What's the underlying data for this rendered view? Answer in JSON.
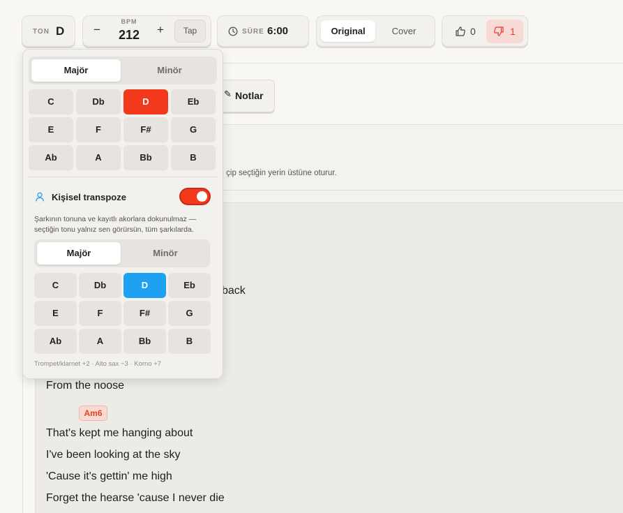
{
  "toolbar": {
    "key": {
      "label": "TON",
      "value": "D"
    },
    "bpm": {
      "label": "BPM",
      "value": "212",
      "minus": "−",
      "plus": "+",
      "tap": "Tap"
    },
    "duration": {
      "label": "SÜRE",
      "value": "6:00"
    },
    "version": {
      "options": [
        "Original",
        "Cover"
      ],
      "selected": "Original"
    },
    "votes": {
      "up": "0",
      "down": "1"
    }
  },
  "content": {
    "notes_button": "Notlar",
    "hint": "ç, çip seçtiğin yerin üstüne oturur.",
    "lyrics": [
      "back",
      "From the noose",
      "That's kept me hanging about",
      "I've been looking at the sky",
      "'Cause it's gettin' me high",
      "Forget the hearse 'cause I never die"
    ],
    "chord": "Am6"
  },
  "popover": {
    "mode_tabs": [
      "Majör",
      "Minör"
    ],
    "keys": [
      "C",
      "Db",
      "D",
      "Eb",
      "E",
      "F",
      "F#",
      "G",
      "Ab",
      "A",
      "Bb",
      "B"
    ],
    "selected_key": "D",
    "personal": {
      "title": "Kişisel transpoze",
      "enabled": true,
      "description": "Şarkının tonuna ve kayıtlı akorlara dokunulmaz — seçtiğin tonu yalnız sen görürsün, tüm şarkılarda.",
      "mode_tabs": [
        "Majör",
        "Minör"
      ],
      "keys": [
        "C",
        "Db",
        "D",
        "Eb",
        "E",
        "F",
        "F#",
        "G",
        "Ab",
        "A",
        "Bb",
        "B"
      ],
      "selected_key": "D"
    },
    "footer": "Trompet/klarnet +2 · Alto sax −3 · Korno +7"
  },
  "colors": {
    "accent_red": "#f2391c",
    "accent_blue": "#1ea1f2",
    "chord_bg": "#fadad3",
    "dislike_bg": "#f7dad5"
  }
}
